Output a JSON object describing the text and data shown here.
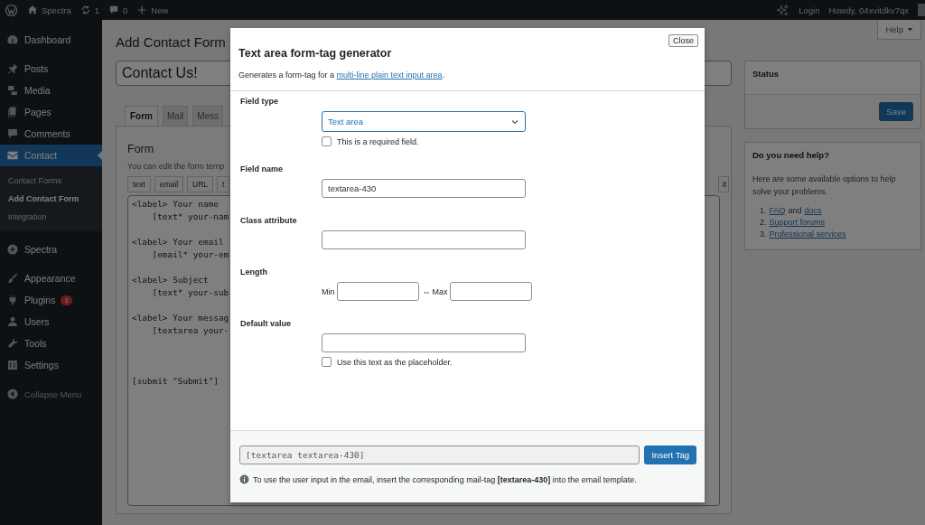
{
  "admin_bar": {
    "site": "Spectra",
    "updates": "1",
    "comments": "0",
    "new": "New",
    "login": "Login",
    "greeting": "Howdy, 04xvitdkv7qx"
  },
  "sidebar": {
    "groups": [
      {
        "items": [
          {
            "label": "Dashboard",
            "selected": false
          }
        ]
      },
      {
        "items": [
          {
            "label": "Posts",
            "selected": false
          },
          {
            "label": "Media",
            "selected": false
          },
          {
            "label": "Pages",
            "selected": false
          },
          {
            "label": "Comments",
            "selected": false
          },
          {
            "label": "Contact",
            "selected": true,
            "children": [
              {
                "label": "Contact Forms",
                "selected": false
              },
              {
                "label": "Add Contact Form",
                "selected": true
              },
              {
                "label": "Integration",
                "selected": false
              }
            ]
          }
        ]
      },
      {
        "items": [
          {
            "label": "Spectra",
            "selected": false
          }
        ]
      },
      {
        "items": [
          {
            "label": "Appearance",
            "selected": false
          },
          {
            "label": "Plugins",
            "selected": false,
            "badge": "1"
          },
          {
            "label": "Users",
            "selected": false
          },
          {
            "label": "Tools",
            "selected": false
          },
          {
            "label": "Settings",
            "selected": false
          }
        ]
      }
    ],
    "collapse": "Collapse Menu"
  },
  "page": {
    "title": "Add Contact Form",
    "help": "Help",
    "form_title": "Contact Us!",
    "tabs": [
      {
        "label": "Form",
        "selected": true
      },
      {
        "label": "Mail",
        "selected": false
      },
      {
        "label": "Mess",
        "selected": false
      }
    ],
    "panel": {
      "heading": "Form",
      "description": "You can edit the form temp",
      "tag_buttons": [
        "text",
        "email",
        "URL",
        "t"
      ],
      "tag_buttons_right": [
        "it"
      ],
      "template": "<label> Your name\n    [text* your-nam\n\n<label> Your email\n    [email* your-em\n\n<label> Subject\n    [text* your-sub\n\n<label> Your messag\n    [textarea your-\n\n\n\n[submit \"Submit\"]"
    }
  },
  "status_box": {
    "title": "Status",
    "save": "Save"
  },
  "help_box": {
    "title": "Do you need help?",
    "text": "Here are some available options to help solve your problems.",
    "items": [
      {
        "number": "1.",
        "parts": [
          {
            "text": "FAQ",
            "link": true
          },
          {
            "text": "and",
            "link": false
          },
          {
            "text": "docs",
            "link": true
          }
        ]
      },
      {
        "number": "2.",
        "parts": [
          {
            "text": "Support forums",
            "link": true
          }
        ]
      },
      {
        "number": "3.",
        "parts": [
          {
            "text": "Professional services",
            "link": true
          }
        ]
      }
    ]
  },
  "modal": {
    "close": "Close",
    "title": "Text area form-tag generator",
    "description_start": "Generates a form-tag for a ",
    "description_link": "multi-line plain text input area",
    "description_end": ".",
    "rows": [
      {
        "kind": "select",
        "label": "Field type",
        "value": "Text area",
        "checkbox": {
          "label": "This is a required field.",
          "checked": false
        }
      },
      {
        "kind": "text",
        "label": "Field name",
        "value": "textarea-430"
      },
      {
        "kind": "text",
        "label": "Class attribute"
      },
      {
        "kind": "range",
        "label": "Length",
        "min_label": "Min",
        "separator": "⇔",
        "max_label": "Max"
      },
      {
        "kind": "text",
        "label": "Default value",
        "checkbox": {
          "label": "Use this text as the placeholder.",
          "checked": false
        }
      }
    ],
    "tag": "[textarea textarea-430]",
    "insert": "Insert Tag",
    "note": "To use the user input in the email, insert the corresponding mail-tag **[textarea-430]** into the email template."
  }
}
